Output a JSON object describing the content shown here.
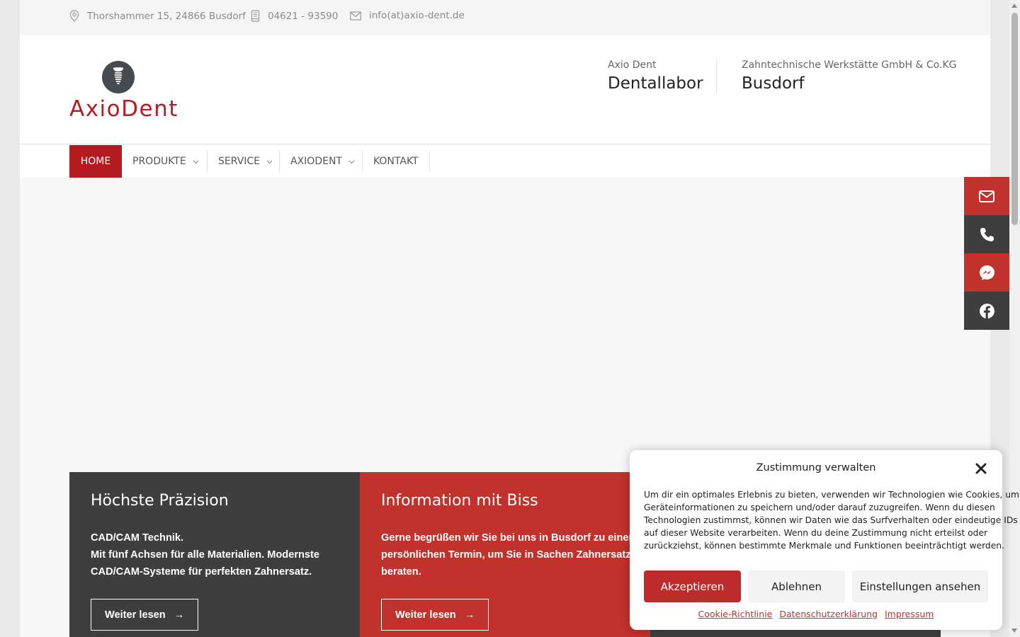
{
  "topbar": {
    "address": "Thorshammer 15, 24866 Busdorf",
    "phone": "04621 - 93590",
    "email": "info(at)axio-dent.de",
    "icons": [
      "map-pin-icon",
      "mobile-phone-icon",
      "envelope-icon"
    ]
  },
  "header": {
    "logo_text": "AxioDent",
    "info": [
      {
        "small": "Axio Dent",
        "big": "Dentallabor"
      },
      {
        "small": "Zahntechnische Werkstätte GmbH & Co.KG",
        "big": "Busdorf"
      }
    ]
  },
  "nav": {
    "items": [
      {
        "label": "HOME",
        "active": true
      },
      {
        "label": "PRODUKTE",
        "dropdown": true
      },
      {
        "label": "SERVICE",
        "dropdown": true
      },
      {
        "label": "AXIODENT",
        "dropdown": true
      },
      {
        "label": "KONTAKT"
      }
    ]
  },
  "boxes": [
    {
      "title": "Höchste Präzision",
      "lines": [
        "CAD/CAM Technik.",
        "Mit fünf Achsen für alle Materialien. Modernste",
        "CAD/CAM-Systeme für perfekten Zahnersatz."
      ],
      "button": "Weiter lesen",
      "arrow": "→"
    },
    {
      "title": "Information mit Biss",
      "lines": [
        "Gerne begrüßen wir Sie bei uns in Busdorf zu einem",
        "persönlichen Termin, um Sie in Sachen Zahnersatz zu",
        "beraten."
      ],
      "button": "Weiter lesen",
      "arrow": "→"
    }
  ],
  "sidebar": {
    "buttons": [
      "envelope-icon",
      "phone-icon",
      "messenger-icon",
      "facebook-icon"
    ]
  },
  "cookie": {
    "title": "Zustimmung verwalten",
    "body_lines": [
      "Um dir ein optimales Erlebnis zu bieten, verwenden wir Technologien wie Cookies, um",
      "Geräteinformationen zu speichern und/oder darauf zuzugreifen. Wenn du diesen",
      "Technologien zustimmst, können wir Daten wie das Surfverhalten oder eindeutige IDs",
      "auf dieser Website verarbeiten. Wenn du deine Zustimmung nicht erteilst oder",
      "zurückziehst, können bestimmte Merkmale und Funktionen beeinträchtigt werden."
    ],
    "accept": "Akzeptieren",
    "deny": "Ablehnen",
    "preferences": "Einstellungen ansehen",
    "links": [
      "Cookie-Richtlinie",
      "Datenschutzerklärung",
      "Impressum"
    ]
  },
  "colors": {
    "brand_red": "#b41b20",
    "box_red": "#c0322b",
    "dark_gray": "#3e3e3e"
  }
}
